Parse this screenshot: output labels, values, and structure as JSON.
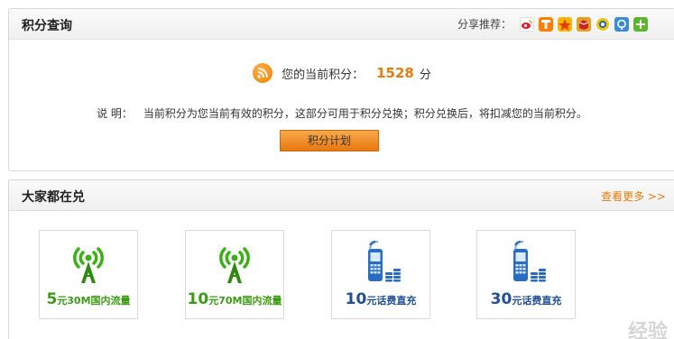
{
  "points_panel": {
    "title": "积分查询",
    "share_label": "分享推荐：",
    "share_icons": [
      "weibo-icon",
      "tudou-icon",
      "qzone-icon",
      "kaixin-icon",
      "renren-icon",
      "douban-icon",
      "more-share-icon"
    ],
    "current_points_label": "您的当前积分：",
    "current_points_value": "1528",
    "points_unit": "分",
    "note_label": "说 明：",
    "note_text": "当前积分为您当前有效的积分，这部分可用于积分兑换；积分兑换后，将扣减您的当前积分。",
    "plan_button": "积分计划"
  },
  "exchange_panel": {
    "title": "大家都在兑",
    "more_link": "查看更多 >>",
    "items": [
      {
        "big": "5",
        "small": "元30M国内流量",
        "icon": "signal-tower-icon",
        "color": "#3a9c12"
      },
      {
        "big": "10",
        "small": "元70M国内流量",
        "icon": "signal-tower-icon",
        "color": "#3a9c12"
      },
      {
        "big": "10",
        "small": "元话费直充",
        "icon": "mobile-phone-coins-icon",
        "color": "#1f4f97"
      },
      {
        "big": "30",
        "small": "元话费直充",
        "icon": "mobile-phone-coins-icon",
        "color": "#1f4f97"
      }
    ]
  },
  "watermark": "经验"
}
